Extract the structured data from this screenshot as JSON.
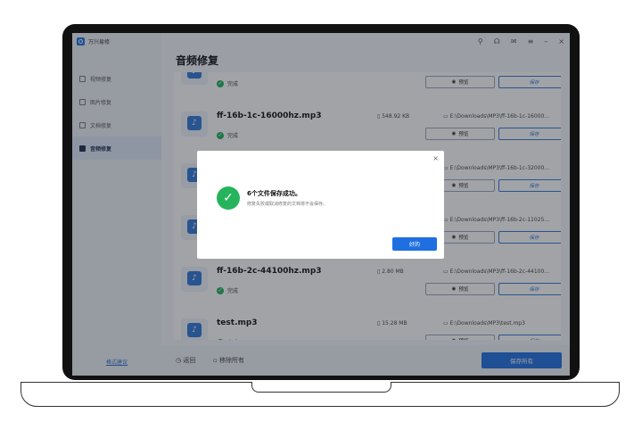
{
  "app": {
    "title": "万兴易修"
  },
  "sidebar": {
    "items": [
      {
        "label": "视频修复",
        "active": false
      },
      {
        "label": "图片修复",
        "active": false
      },
      {
        "label": "文档修复",
        "active": false
      },
      {
        "label": "音频修复",
        "active": true
      }
    ],
    "feedback": "格式建议"
  },
  "window_controls": [
    "person-icon",
    "headset-icon",
    "mail-icon",
    "menu-icon",
    "minimize-icon",
    "close-icon"
  ],
  "main": {
    "title": "音频修复",
    "files": [
      {
        "name": "",
        "size": "",
        "path": "",
        "status": "完成"
      },
      {
        "name": "ff-16b-1c-16000hz.mp3",
        "size": "548.92  KB",
        "path": "E:\\Downloads\\MP3\\ff-16b-1c-16000...",
        "status": "完成"
      },
      {
        "name": "",
        "size": "",
        "path": "E:\\Downloads\\MP3\\ff-16b-1c-32000...",
        "status": ""
      },
      {
        "name": "",
        "size": "",
        "path": "E:\\Downloads\\MP3\\ff-16b-2c-11025...",
        "status": ""
      },
      {
        "name": "ff-16b-2c-44100hz.mp3",
        "size": "2.80  MB",
        "path": "E:\\Downloads\\MP3\\ff-16b-2c-44100...",
        "status": "完成"
      },
      {
        "name": "test.mp3",
        "size": "15.28  MB",
        "path": "E:\\Downloads\\MP3\\test.mp3",
        "status": "完成"
      }
    ],
    "preview_label": "预览",
    "save_label": "保存"
  },
  "footer": {
    "back": "返回",
    "remove_all": "移除所有",
    "save_all": "保存所有"
  },
  "dialog": {
    "title": "6个文件保存成功。",
    "subtitle": "修复失败或取消修复的文档将不会保存。",
    "ok": "好的",
    "close": "×"
  },
  "colors": {
    "accent": "#1f6fe0",
    "success": "#25b45c"
  }
}
